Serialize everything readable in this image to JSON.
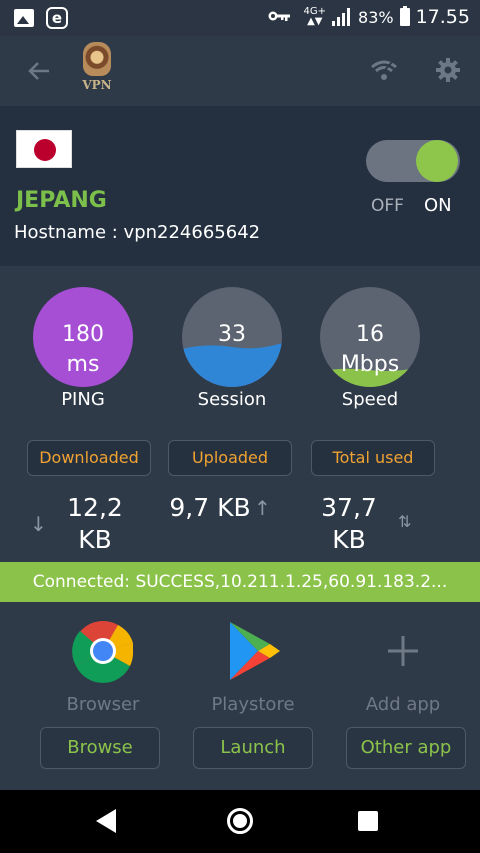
{
  "status_bar": {
    "network_type": "4G+",
    "battery": "83%",
    "time": "17.55",
    "icons": [
      "image-icon",
      "e-app-icon",
      "vpn-key-icon",
      "signal-icon",
      "battery-icon"
    ]
  },
  "toolbar": {
    "logo_text": "VPN",
    "icons": [
      "back-arrow-icon",
      "vpn-logo",
      "wifi-icon",
      "gear-icon"
    ]
  },
  "server": {
    "flag": "japan-flag",
    "country": "JEPANG",
    "hostname": "Hostname : vpn224665642",
    "toggle_off_label": "OFF",
    "toggle_on_label": "ON",
    "toggle_state": "on"
  },
  "stats": {
    "ping": {
      "value": "180",
      "unit": "ms",
      "label": "PING"
    },
    "session": {
      "value": "33",
      "label": "Session"
    },
    "speed": {
      "value": "16",
      "unit": "Mbps",
      "label": "Speed"
    }
  },
  "traffic": {
    "downloaded_label": "Downloaded",
    "uploaded_label": "Uploaded",
    "total_label": "Total used",
    "downloaded_value": "12,2",
    "downloaded_unit": "KB",
    "uploaded_value": "9,7 KB",
    "total_value": "37,7",
    "total_unit": "KB"
  },
  "banner": {
    "text": "Connected: SUCCESS,10.211.1.25,60.91.183.2..."
  },
  "apps": [
    {
      "name": "Browser",
      "button": "Browse",
      "icon": "chrome-icon"
    },
    {
      "name": "Playstore",
      "button": "Launch",
      "icon": "play-store-icon"
    },
    {
      "name": "Add app",
      "button": "Other app",
      "icon": "plus-icon"
    }
  ],
  "colors": {
    "background": "#2f3a48",
    "panel": "#243040",
    "accent_green": "#8bc34a",
    "badge_orange": "#f0a232",
    "ping_purple": "#a64fd5",
    "session_blue": "#2f86d6"
  }
}
